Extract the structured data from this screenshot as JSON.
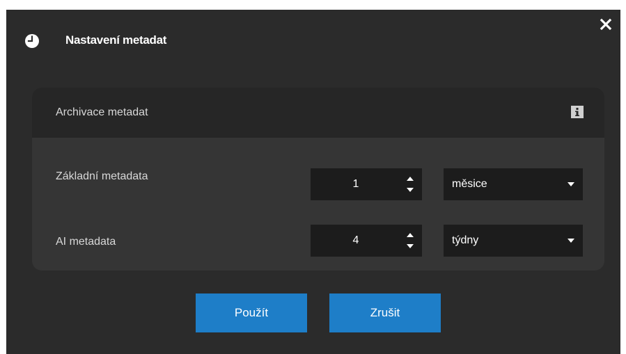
{
  "dialog": {
    "title": "Nastavení metadat",
    "title_icon": "clock-icon",
    "close_icon": "close-icon"
  },
  "panel": {
    "title": "Archivace metadat",
    "info_icon": "info-icon",
    "rows": [
      {
        "label": "Základní metadata",
        "value": "1",
        "unit": "měsice"
      },
      {
        "label": "AI metadata",
        "value": "4",
        "unit": "týdny"
      }
    ]
  },
  "buttons": {
    "apply": "Použít",
    "cancel": "Zrušit"
  },
  "colors": {
    "background": "#2b2b2b",
    "panel": "#353535",
    "panel_header": "#262626",
    "input": "#1c1c1c",
    "accent": "#1e7ec8"
  }
}
